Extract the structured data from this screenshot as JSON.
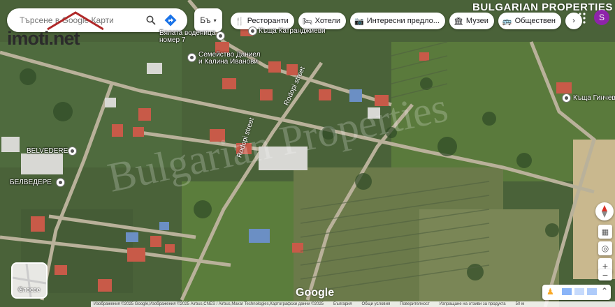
{
  "search": {
    "placeholder": "Търсене в Google Карти"
  },
  "layer_toggle": {
    "label": "Бъ"
  },
  "chips": [
    {
      "label": "Ресторанти",
      "icon": "fork-knife-icon",
      "glyph": "🍴"
    },
    {
      "label": "Хотели",
      "icon": "bed-icon",
      "glyph": "🛏"
    },
    {
      "label": "Интересни предло...",
      "icon": "camera-icon",
      "glyph": "📷"
    },
    {
      "label": "Музеи",
      "icon": "museum-icon",
      "glyph": "🏛"
    },
    {
      "label": "Обществен",
      "icon": "bus-icon",
      "glyph": "🚌"
    }
  ],
  "watermark": {
    "logo": "imoti.net",
    "brand": "BULGARIAN PROPERTIES"
  },
  "account": {
    "initial": "S"
  },
  "places": [
    {
      "name": "Бялата воденица",
      "line2": "номер 7"
    },
    {
      "name": "Къща Катранджиеви"
    },
    {
      "name": "Семейство Даниел",
      "line2": "и Калина Иванови"
    },
    {
      "name": "Къща Гинчев"
    },
    {
      "name": "BELVEDERE"
    },
    {
      "name": "БЕЛВЕДЕРЕ"
    }
  ],
  "streets": {
    "a": "Rodopi street",
    "b": "Rodopi street"
  },
  "layers_label": "Слоеве",
  "google_logo": "Google",
  "footer": {
    "attribution": "Изображения ©2025 Google,Изображения ©2025 Airbus,CNES / Airbus,Maxar Technologies,Картографски данни ©2025",
    "country": "България",
    "terms": "Общи условия",
    "privacy": "Поверителност",
    "feedback": "Изпращане на отзиви за продукта",
    "scale": "50 м"
  }
}
